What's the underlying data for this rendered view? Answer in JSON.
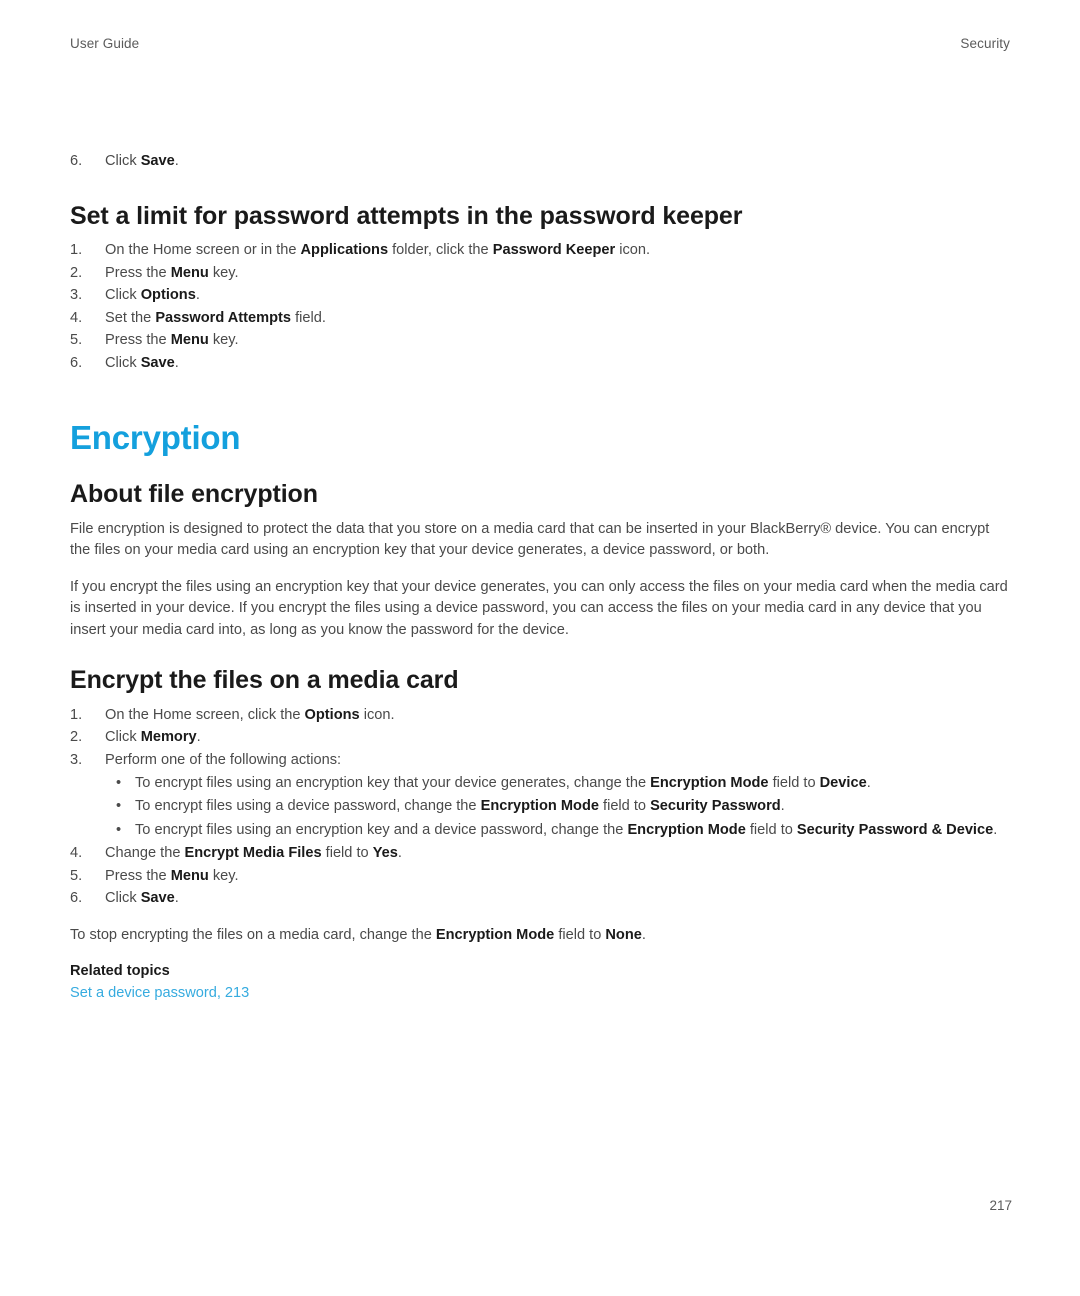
{
  "colors": {
    "chapter_heading": "#14a0dd",
    "link": "#36abdf",
    "body_text": "#4a4a4a",
    "bold_text": "#1a1a1a"
  },
  "running_head": {
    "left": "User Guide",
    "right": "Security"
  },
  "folio": {
    "page_number": "217"
  },
  "orphan_step": {
    "number": "6.",
    "text_before": "Click ",
    "bold": "Save",
    "text_after": "."
  },
  "section_password_keeper": {
    "heading": "Set a limit for password attempts in the password keeper",
    "steps": [
      {
        "number": "1.",
        "parts": [
          {
            "text": "On the Home screen or in the ",
            "bold": false
          },
          {
            "text": "Applications",
            "bold": true
          },
          {
            "text": " folder, click the ",
            "bold": false
          },
          {
            "text": "Password Keeper",
            "bold": true
          },
          {
            "text": " icon.",
            "bold": false
          }
        ]
      },
      {
        "number": "2.",
        "parts": [
          {
            "text": "Press the ",
            "bold": false
          },
          {
            "text": "Menu",
            "bold": true
          },
          {
            "text": " key.",
            "bold": false
          }
        ]
      },
      {
        "number": "3.",
        "parts": [
          {
            "text": "Click ",
            "bold": false
          },
          {
            "text": "Options",
            "bold": true
          },
          {
            "text": ".",
            "bold": false
          }
        ]
      },
      {
        "number": "4.",
        "parts": [
          {
            "text": "Set the ",
            "bold": false
          },
          {
            "text": "Password Attempts",
            "bold": true
          },
          {
            "text": " field.",
            "bold": false
          }
        ]
      },
      {
        "number": "5.",
        "parts": [
          {
            "text": "Press the ",
            "bold": false
          },
          {
            "text": "Menu",
            "bold": true
          },
          {
            "text": " key.",
            "bold": false
          }
        ]
      },
      {
        "number": "6.",
        "parts": [
          {
            "text": "Click ",
            "bold": false
          },
          {
            "text": "Save",
            "bold": true
          },
          {
            "text": ".",
            "bold": false
          }
        ]
      }
    ]
  },
  "chapter": {
    "title": "Encryption"
  },
  "section_about_file_encryption": {
    "heading": "About file encryption",
    "paragraphs": [
      "File encryption is designed to protect the data that you store on a media card that can be inserted in your BlackBerry® device. You can encrypt the files on your media card using an encryption key that your device generates, a device password, or both.",
      "If you encrypt the files using an encryption key that your device generates, you can only access the files on your media card when the media card is inserted in your device. If you encrypt the files using a device password, you can access the files on your media card in any device that you insert your media card into, as long as you know the password for the device."
    ]
  },
  "section_encrypt_media_card": {
    "heading": "Encrypt the files on a media card",
    "steps": [
      {
        "number": "1.",
        "parts": [
          {
            "text": "On the Home screen, click the ",
            "bold": false
          },
          {
            "text": "Options",
            "bold": true
          },
          {
            "text": " icon.",
            "bold": false
          }
        ]
      },
      {
        "number": "2.",
        "parts": [
          {
            "text": "Click ",
            "bold": false
          },
          {
            "text": "Memory",
            "bold": true
          },
          {
            "text": ".",
            "bold": false
          }
        ]
      },
      {
        "number": "3.",
        "parts": [
          {
            "text": "Perform one of the following actions:",
            "bold": false
          }
        ]
      }
    ],
    "bullets": [
      {
        "marker": "•",
        "parts": [
          {
            "text": "To encrypt files using an encryption key that your device generates, change the ",
            "bold": false
          },
          {
            "text": "Encryption Mode",
            "bold": true
          },
          {
            "text": " field to ",
            "bold": false
          },
          {
            "text": "Device",
            "bold": true
          },
          {
            "text": ".",
            "bold": false
          }
        ]
      },
      {
        "marker": "•",
        "parts": [
          {
            "text": "To encrypt files using a device password, change the ",
            "bold": false
          },
          {
            "text": "Encryption Mode",
            "bold": true
          },
          {
            "text": " field to ",
            "bold": false
          },
          {
            "text": "Security Password",
            "bold": true
          },
          {
            "text": ".",
            "bold": false
          }
        ]
      },
      {
        "marker": "•",
        "parts": [
          {
            "text": "To encrypt files using an encryption key and a device password, change the ",
            "bold": false
          },
          {
            "text": "Encryption Mode",
            "bold": true
          },
          {
            "text": " field to ",
            "bold": false
          },
          {
            "text": "Security Password & Device",
            "bold": true
          },
          {
            "text": ".",
            "bold": false
          }
        ]
      }
    ],
    "steps_after": [
      {
        "number": "4.",
        "parts": [
          {
            "text": "Change the ",
            "bold": false
          },
          {
            "text": "Encrypt Media Files",
            "bold": true
          },
          {
            "text": " field to ",
            "bold": false
          },
          {
            "text": "Yes",
            "bold": true
          },
          {
            "text": ".",
            "bold": false
          }
        ]
      },
      {
        "number": "5.",
        "parts": [
          {
            "text": "Press the ",
            "bold": false
          },
          {
            "text": "Menu",
            "bold": true
          },
          {
            "text": " key.",
            "bold": false
          }
        ]
      },
      {
        "number": "6.",
        "parts": [
          {
            "text": "Click ",
            "bold": false
          },
          {
            "text": "Save",
            "bold": true
          },
          {
            "text": ".",
            "bold": false
          }
        ]
      }
    ],
    "closing_paragraph": [
      {
        "text": "To stop encrypting the files on a media card, change the ",
        "bold": false
      },
      {
        "text": "Encryption Mode",
        "bold": true
      },
      {
        "text": " field to ",
        "bold": false
      },
      {
        "text": "None",
        "bold": true
      },
      {
        "text": ".",
        "bold": false
      }
    ]
  },
  "related_topics": {
    "title": "Related topics",
    "links": [
      "Set a device password, 213"
    ]
  }
}
